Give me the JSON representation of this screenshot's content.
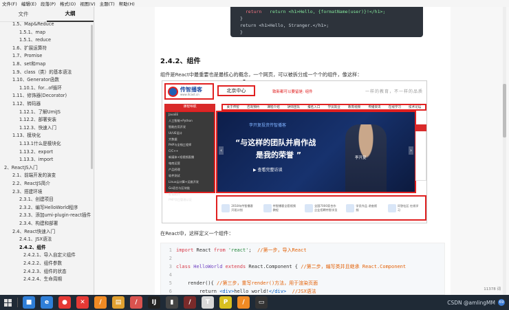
{
  "menubar": [
    "文件(F)",
    "编辑(E)",
    "段落(P)",
    "格式(O)",
    "视图(V)",
    "主题(T)",
    "帮助(H)"
  ],
  "sidebar": {
    "tabs": [
      "文件",
      "大纲"
    ],
    "active_tab": "大纲",
    "toc": [
      {
        "label": "1.5、Map&Reduce",
        "level": 2
      },
      {
        "label": "1.5.1、map",
        "level": 3
      },
      {
        "label": "1.5.1、reduce",
        "level": 3
      },
      {
        "label": "1.6、扩展运算符",
        "level": 2
      },
      {
        "label": "1.7、Promise",
        "level": 2
      },
      {
        "label": "1.8、set和map",
        "level": 2
      },
      {
        "label": "1.9、class（类）的基本语法",
        "level": 2
      },
      {
        "label": "1.10、Generator函数",
        "level": 2
      },
      {
        "label": "1.10.1、for...of循环",
        "level": 3
      },
      {
        "label": "1.11、修饰器(Decorator)",
        "level": 2
      },
      {
        "label": "1.12、转码器",
        "level": 2
      },
      {
        "label": "1.12.1、了解UmiJS",
        "level": 3
      },
      {
        "label": "1.12.2、部署安装",
        "level": 3
      },
      {
        "label": "1.12.3、快速入门",
        "level": 3
      },
      {
        "label": "1.13、模块化",
        "level": 2
      },
      {
        "label": "1.13.1什么是模块化",
        "level": 3
      },
      {
        "label": "1.13.2、export",
        "level": 3
      },
      {
        "label": "1.13.3、import",
        "level": 3
      },
      {
        "label": "2、ReactJS入门",
        "level": 1
      },
      {
        "label": "2.1、前端开发的演变",
        "level": 2
      },
      {
        "label": "2.2、ReactJS简介",
        "level": 2
      },
      {
        "label": "2.3、搭建环境",
        "level": 2
      },
      {
        "label": "2.3.1、创建项目",
        "level": 3
      },
      {
        "label": "2.3.2、编写HelloWorld程序",
        "level": 3
      },
      {
        "label": "2.3.3、添加umi-plugin-react插件",
        "level": 3
      },
      {
        "label": "2.3.4、构建和部署",
        "level": 3
      },
      {
        "label": "2.4、React快速入门",
        "level": 2
      },
      {
        "label": "2.4.1、JSX语法",
        "level": 3
      },
      {
        "label": "2.4.2、组件",
        "level": 3,
        "active": true
      },
      {
        "label": "2.4.2.1、导入自定义组件",
        "level": 4
      },
      {
        "label": "2.4.2.2、组件参数",
        "level": 4
      },
      {
        "label": "2.4.2.3、组件的状态",
        "level": 4
      },
      {
        "label": "2.4.2.4、生命周期",
        "level": 4
      }
    ]
  },
  "doc": {
    "code_top": [
      "  return <h1>Hello, {formatName(user)}!</h1>;",
      "}",
      "return <h1>Hello, Stranger.</h1>;",
      "}"
    ],
    "heading": "2.4.2、组件",
    "para1": "组件是React中最重要也是最核心的概念，一个网页，可以被拆分成一个个的组件，像这样：",
    "para2": "在React中，这样定义一个组件：",
    "word_count": "11378 词",
    "code_bottom": [
      {
        "n": "1",
        "parts": [
          [
            "c-kw",
            "import "
          ],
          [
            "",
            "React "
          ],
          [
            "c-kw",
            "from "
          ],
          [
            "c-str",
            "'react'"
          ],
          [
            "",
            ";  "
          ],
          [
            "c-com",
            "//第一步，导入React"
          ]
        ]
      },
      {
        "n": "2",
        "parts": []
      },
      {
        "n": "3",
        "parts": [
          [
            "c-kw",
            "class "
          ],
          [
            "c-cls",
            "HelloWorld "
          ],
          [
            "c-kw",
            "extends "
          ],
          [
            "",
            "React.Component { "
          ],
          [
            "c-com",
            "//第二步，编写类并且继承 React.Component"
          ]
        ]
      },
      {
        "n": "4",
        "parts": []
      },
      {
        "n": "5",
        "parts": [
          [
            "",
            "    render(){ "
          ],
          [
            "c-com",
            "//第三步，重写render()方法，用于渲染页面"
          ]
        ]
      },
      {
        "n": "6",
        "parts": [
          [
            "",
            "        return "
          ],
          [
            "c-tag",
            "<div>"
          ],
          [
            "",
            "hello world!"
          ],
          [
            "c-tag",
            "</div>"
          ],
          [
            "",
            "  "
          ],
          [
            "c-com",
            "//JSX语法"
          ]
        ]
      }
    ]
  },
  "web": {
    "logo": "传智播客",
    "logo_sub": "www.itcast.cn",
    "city": "北京中心",
    "tag": "致新都可以要留是: 组件",
    "slogan": "一样的教育，不一样的品质",
    "nav_left": "课程导航",
    "nav": [
      "关于传智",
      "咨询预约",
      "课程介绍",
      "讲师团队",
      "报名入口",
      "学员就业",
      "教育视频",
      "传播资讯",
      "在线学习",
      "技术论坛"
    ],
    "side_items": [
      "JavaEE",
      "人工智能+Python",
      "智能应用开发",
      "UI/UE设计",
      "大数据",
      "PHP与全栈工程师",
      "C/C++",
      "新媒体+短视频直播",
      "电商运营",
      "产品经理",
      "软件测试",
      "Linux云计算+运维开发",
      "Go语言与区块链",
      "影视制作",
      "PMP项目管理认证"
    ],
    "banner_small": "李开复投资传智播客",
    "banner_line1": "“与这样的团队并肩作战",
    "banner_line2": "是我的荣誉 ”",
    "banner_btn": "▶ 查看完整访谈",
    "banner_name": "李开复",
    "bottom": [
      "2018年传智播客开班计划",
      "传智播客全套视频教程",
      "全国7000家合作企业招聘传智学员",
      "学员作品 讲座视频",
      "问答社区 在线学习"
    ]
  },
  "taskbar": {
    "apps": [
      {
        "name": "explorer-icon",
        "color": "#2f7fd8",
        "glyph": "■"
      },
      {
        "name": "edge-icon",
        "color": "#2f7fd8",
        "glyph": "e"
      },
      {
        "name": "chrome-icon",
        "color": "#e53935",
        "glyph": "●"
      },
      {
        "name": "xmind-icon",
        "color": "#e53935",
        "glyph": "✕"
      },
      {
        "name": "app-orange-icon",
        "color": "#f08a24",
        "glyph": "/"
      },
      {
        "name": "archive-icon",
        "color": "#e0a030",
        "glyph": "▤"
      },
      {
        "name": "app-red-icon",
        "color": "#d9534f",
        "glyph": "/"
      },
      {
        "name": "intellij-icon",
        "color": "#222",
        "glyph": "IJ"
      },
      {
        "name": "typora-icon",
        "color": "#444",
        "glyph": "▮"
      },
      {
        "name": "app-dark-icon",
        "color": "#7a2a2a",
        "glyph": "/"
      },
      {
        "name": "text-icon",
        "color": "#d8d8d8",
        "glyph": "T"
      },
      {
        "name": "ps-icon",
        "color": "#d8c020",
        "glyph": "P"
      },
      {
        "name": "app-orange2-icon",
        "color": "#f08a24",
        "glyph": "/"
      },
      {
        "name": "terminal-icon",
        "color": "#333",
        "glyph": "▭"
      }
    ],
    "watermark": "CSDN @amlingMM",
    "badge": "69"
  }
}
